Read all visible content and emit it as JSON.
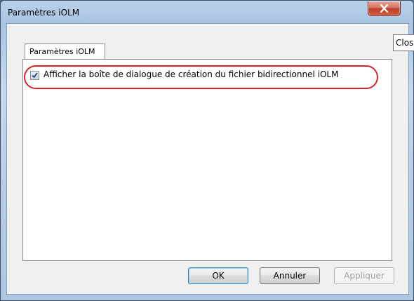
{
  "window": {
    "title": "Paramètres iOLM",
    "close_tooltip": "Clos"
  },
  "tabs": [
    {
      "label": "Paramètres iOLM",
      "selected": true
    }
  ],
  "options": {
    "show_bidirectional_dialog": {
      "label": "Afficher la boîte de dialogue de création du fichier bidirectionnel iOLM",
      "checked": true
    }
  },
  "buttons": {
    "ok": "OK",
    "cancel": "Annuler",
    "apply": "Appliquer"
  },
  "icons": {
    "close": "close-icon",
    "check": "checkmark-icon"
  },
  "colors": {
    "highlight": "#d8232a",
    "close_button": "#c0412b"
  }
}
